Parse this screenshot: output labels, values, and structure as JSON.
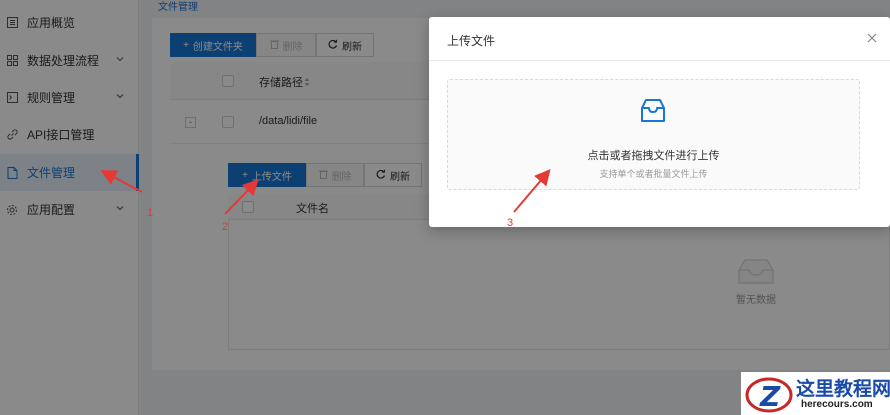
{
  "sidebar": {
    "items": [
      {
        "label": "应用概览",
        "icon": "document-grid-icon",
        "expandable": false,
        "active": false
      },
      {
        "label": "数据处理流程",
        "icon": "grid-icon",
        "expandable": true,
        "active": false
      },
      {
        "label": "规则管理",
        "icon": "terminal-icon",
        "expandable": true,
        "active": false
      },
      {
        "label": "API接口管理",
        "icon": "link-icon",
        "expandable": false,
        "active": false
      },
      {
        "label": "文件管理",
        "icon": "file-icon",
        "expandable": false,
        "active": true
      },
      {
        "label": "应用配置",
        "icon": "gear-icon",
        "expandable": true,
        "active": false
      }
    ]
  },
  "breadcrumb": "文件管理",
  "toolbar": {
    "create_folder": "创建文件夹",
    "delete": "删除",
    "refresh": "刷新"
  },
  "folder_table": {
    "columns": [
      "存储路径"
    ],
    "rows": [
      {
        "path": "/data/lidi/file",
        "expand_symbol": "-"
      }
    ]
  },
  "file_toolbar": {
    "upload": "上传文件",
    "delete": "删除",
    "refresh": "刷新"
  },
  "file_table": {
    "columns": [
      "文件名"
    ],
    "empty_text": "暂无数据"
  },
  "modal": {
    "title": "上传文件",
    "dropzone_main": "点击或者拖拽文件进行上传",
    "dropzone_hint": "支持单个或者批量文件上传"
  },
  "annotations": [
    "1",
    "2",
    "3"
  ],
  "watermark": {
    "title": "这里教程网",
    "url": "herecours.com",
    "logo_letter": "Z"
  },
  "colors": {
    "primary": "#1976d2",
    "annotation": "#e53935",
    "overlay": "rgba(0,0,0,0.46)"
  }
}
